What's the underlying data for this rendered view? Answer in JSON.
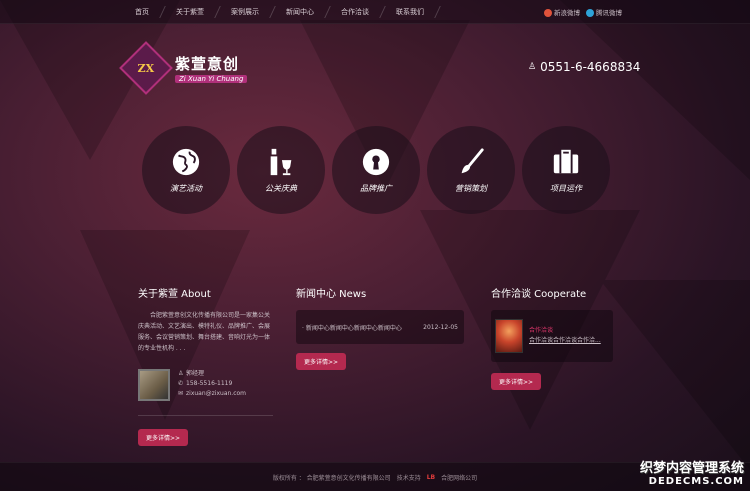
{
  "nav": {
    "items": [
      {
        "label": "首页"
      },
      {
        "label": "关于紫萱"
      },
      {
        "label": "案例展示"
      },
      {
        "label": "新闻中心"
      },
      {
        "label": "合作洽谈"
      },
      {
        "label": "联系我们"
      }
    ],
    "social": [
      {
        "label": "新浪微博",
        "color": "#e0533b"
      },
      {
        "label": "腾讯微博",
        "color": "#2ea3d8"
      }
    ]
  },
  "logo": {
    "mark": "ZX",
    "name": "紫萱意创",
    "pinyin": "Zi Xuan Yi Chuang"
  },
  "phone": "0551-6-4668834",
  "services": [
    {
      "label": "演艺活动",
      "icon": "globe-icon"
    },
    {
      "label": "公关庆典",
      "icon": "wine-icon"
    },
    {
      "label": "品牌推广",
      "icon": "keyhole-icon"
    },
    {
      "label": "营销策划",
      "icon": "brush-icon"
    },
    {
      "label": "项目运作",
      "icon": "briefcase-icon"
    }
  ],
  "about": {
    "title": "关于紫萱 About",
    "text": "合肥紫萱意创文化传播有限公司是一家集公关庆典活动、文艺演出、模特礼仪、品牌推广、会展服务、会议营销策划、舞台搭建、音响灯光为一体的专业性机构 . . .",
    "contact": {
      "name": "郭经理",
      "phone": "158-5516-1119",
      "email": "zixuan@zixuan.com"
    },
    "more": "更多详情>>"
  },
  "news": {
    "title": "新闻中心 News",
    "items": [
      {
        "title": "· 新闻中心新闻中心新闻中心新闻中心",
        "date": "2012-12-05"
      }
    ],
    "more": "更多详情>>"
  },
  "coop": {
    "title": "合作洽谈 Cooperate",
    "card": {
      "heading": "合作洽谈",
      "text": "合作洽谈合作洽谈合作洽..."
    },
    "more": "更多详情>>"
  },
  "footer": {
    "copyright": "版权所有 ： 合肥紫萱意创文化传播有限公司",
    "support": "技术支持",
    "badge": "LB",
    "company": "合肥网络公司"
  },
  "watermark": {
    "line1": "织梦内容管理系统",
    "line2": "DEDECMS.COM"
  }
}
